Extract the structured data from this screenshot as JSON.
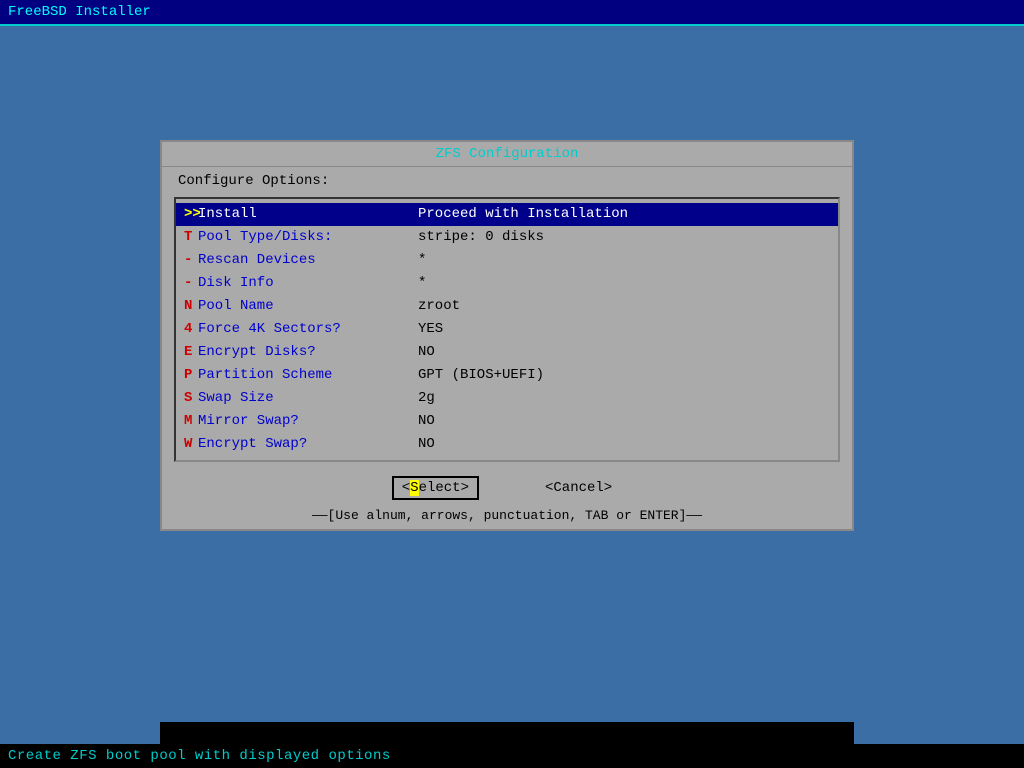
{
  "topbar": {
    "title": "FreeBSD Installer"
  },
  "dialog": {
    "title": "ZFS Configuration",
    "subtitle": "Configure Options:",
    "menu_items": [
      {
        "key": ">>",
        "label": " Install",
        "value": "Proceed with Installation",
        "selected": true
      },
      {
        "key": "T",
        "label": " Pool Type/Disks:",
        "value": "stripe: 0 disks",
        "selected": false
      },
      {
        "key": "-",
        "label": " Rescan Devices",
        "value": "*",
        "selected": false
      },
      {
        "key": "-",
        "label": " Disk Info",
        "value": "*",
        "selected": false
      },
      {
        "key": "N",
        "label": " Pool Name",
        "value": "zroot",
        "selected": false
      },
      {
        "key": "4",
        "label": " Force 4K Sectors?",
        "value": "YES",
        "selected": false
      },
      {
        "key": "E",
        "label": " Encrypt Disks?",
        "value": "NO",
        "selected": false
      },
      {
        "key": "P",
        "label": " Partition Scheme",
        "value": "GPT (BIOS+UEFI)",
        "selected": false
      },
      {
        "key": "S",
        "label": " Swap Size",
        "value": "2g",
        "selected": false
      },
      {
        "key": "M",
        "label": " Mirror Swap?",
        "value": "NO",
        "selected": false
      },
      {
        "key": "W",
        "label": " Encrypt Swap?",
        "value": "NO",
        "selected": false
      }
    ]
  },
  "buttons": {
    "select_label": "Select",
    "select_highlight": "S",
    "select_prefix": "<",
    "select_suffix": ">",
    "cancel_label": "<Cancel>"
  },
  "hint": "——[Use alnum, arrows, punctuation, TAB or ENTER]——",
  "bottombar": {
    "text": "Create ZFS boot pool with displayed options"
  }
}
